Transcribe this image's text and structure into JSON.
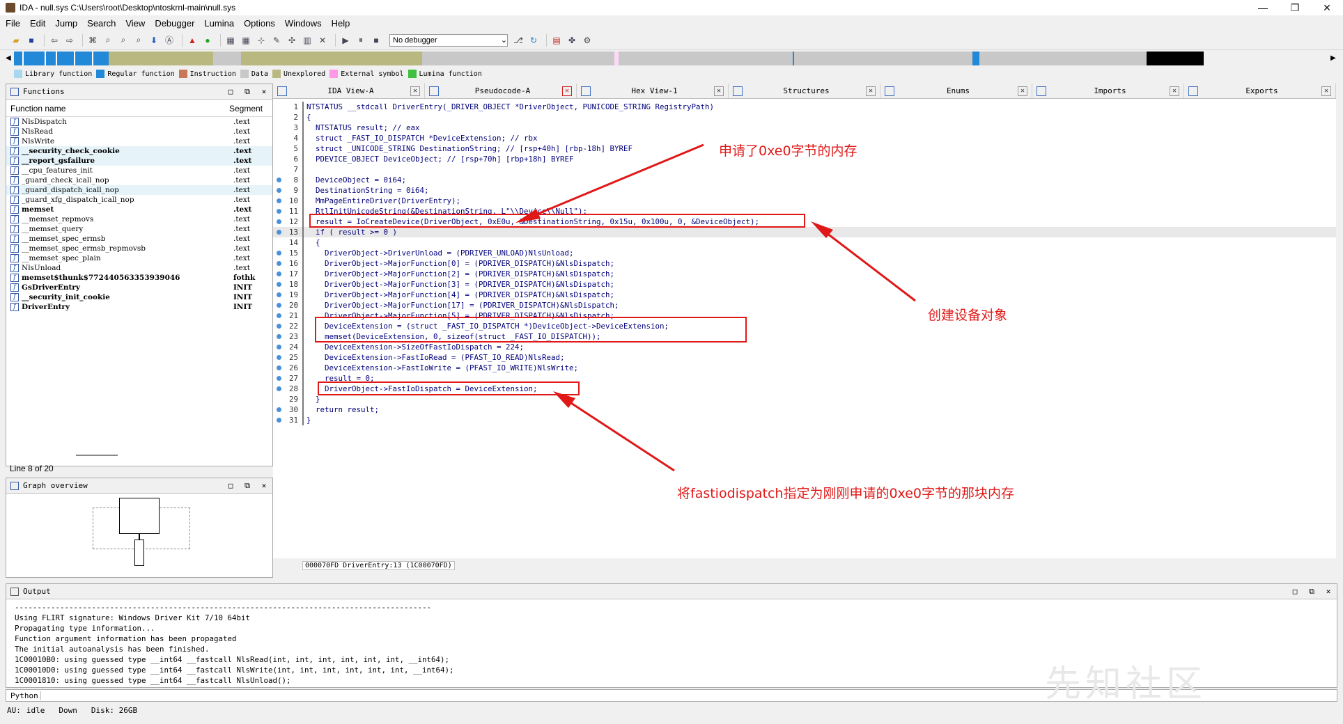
{
  "window": {
    "title": "IDA - null.sys C:\\Users\\root\\Desktop\\ntoskrnl-main\\null.sys",
    "minimize": "—",
    "maximize": "❐",
    "close": "✕"
  },
  "menu": [
    "File",
    "Edit",
    "Jump",
    "Search",
    "View",
    "Debugger",
    "Lumina",
    "Options",
    "Windows",
    "Help"
  ],
  "toolbar": {
    "debugger": "No debugger"
  },
  "legend": [
    {
      "label": "Library function",
      "color": "#a8d8f0"
    },
    {
      "label": "Regular function",
      "color": "#2288d8"
    },
    {
      "label": "Instruction",
      "color": "#c87858"
    },
    {
      "label": "Data",
      "color": "#c8c8c8"
    },
    {
      "label": "Unexplored",
      "color": "#b8b880"
    },
    {
      "label": "External symbol",
      "color": "#ff98e8"
    },
    {
      "label": "Lumina function",
      "color": "#40c040"
    }
  ],
  "navband": [
    {
      "w": 12,
      "c": "#2288d8"
    },
    {
      "w": 2,
      "c": "#fff"
    },
    {
      "w": 30,
      "c": "#2288d8"
    },
    {
      "w": 2,
      "c": "#fff"
    },
    {
      "w": 14,
      "c": "#2288d8"
    },
    {
      "w": 2,
      "c": "#fff"
    },
    {
      "w": 24,
      "c": "#2288d8"
    },
    {
      "w": 2,
      "c": "#fff"
    },
    {
      "w": 24,
      "c": "#2288d8"
    },
    {
      "w": 2,
      "c": "#fff"
    },
    {
      "w": 22,
      "c": "#2288d8"
    },
    {
      "w": 150,
      "c": "#b8b880"
    },
    {
      "w": 40,
      "c": "#c8c8c8"
    },
    {
      "w": 260,
      "c": "#b8b880"
    },
    {
      "w": 276,
      "c": "#c8c8c8"
    },
    {
      "w": 6,
      "c": "#ffd8f8"
    },
    {
      "w": 250,
      "c": "#c8c8c8"
    },
    {
      "w": 2,
      "c": "#2288d8"
    },
    {
      "w": 256,
      "c": "#c8c8c8"
    },
    {
      "w": 10,
      "c": "#2288d8"
    },
    {
      "w": 240,
      "c": "#c8c8c8"
    },
    {
      "w": 82,
      "c": "#000"
    }
  ],
  "functions": {
    "title": "Functions",
    "col_name": "Function name",
    "col_segment": "Segment",
    "rows": [
      {
        "name": "NlsDispatch",
        "seg": ".text",
        "bold": false,
        "hl": false
      },
      {
        "name": "NlsRead",
        "seg": ".text",
        "bold": false,
        "hl": false
      },
      {
        "name": "NlsWrite",
        "seg": ".text",
        "bold": false,
        "hl": false
      },
      {
        "name": "__security_check_cookie",
        "seg": ".text",
        "bold": true,
        "hl": true
      },
      {
        "name": "__report_gsfailure",
        "seg": ".text",
        "bold": true,
        "hl": true
      },
      {
        "name": "__cpu_features_init",
        "seg": ".text",
        "bold": false,
        "hl": false
      },
      {
        "name": "_guard_check_icall_nop",
        "seg": ".text",
        "bold": false,
        "hl": false
      },
      {
        "name": "_guard_dispatch_icall_nop",
        "seg": ".text",
        "bold": false,
        "hl": true
      },
      {
        "name": "_guard_xfg_dispatch_icall_nop",
        "seg": ".text",
        "bold": false,
        "hl": false
      },
      {
        "name": "memset",
        "seg": ".text",
        "bold": true,
        "hl": false
      },
      {
        "name": "__memset_repmovs",
        "seg": ".text",
        "bold": false,
        "hl": false
      },
      {
        "name": "__memset_query",
        "seg": ".text",
        "bold": false,
        "hl": false
      },
      {
        "name": "__memset_spec_ermsb",
        "seg": ".text",
        "bold": false,
        "hl": false
      },
      {
        "name": "__memset_spec_ermsb_repmovsb",
        "seg": ".text",
        "bold": false,
        "hl": false
      },
      {
        "name": "__memset_spec_plain",
        "seg": ".text",
        "bold": false,
        "hl": false
      },
      {
        "name": "NlsUnload",
        "seg": ".text",
        "bold": false,
        "hl": false
      },
      {
        "name": "memset$thunk$772440563353939046",
        "seg": "fothk",
        "bold": true,
        "hl": false
      },
      {
        "name": "GsDriverEntry",
        "seg": "INIT",
        "bold": true,
        "hl": false
      },
      {
        "name": "__security_init_cookie",
        "seg": "INIT",
        "bold": true,
        "hl": false
      },
      {
        "name": "DriverEntry",
        "seg": "INIT",
        "bold": true,
        "hl": false
      }
    ],
    "line_status": "Line 8 of 20"
  },
  "graph": {
    "title": "Graph overview"
  },
  "tabs": [
    {
      "label": "IDA View-A",
      "active": false
    },
    {
      "label": "Pseudocode-A",
      "active": true
    },
    {
      "label": "Hex View-1",
      "active": false
    },
    {
      "label": "Structures",
      "active": false
    },
    {
      "label": "Enums",
      "active": false
    },
    {
      "label": "Imports",
      "active": false
    },
    {
      "label": "Exports",
      "active": false
    }
  ],
  "code": [
    {
      "n": "1",
      "t": "NTSTATUS __stdcall DriverEntry(_DRIVER_OBJECT *DriverObject, PUNICODE_STRING RegistryPath)",
      "dot": false
    },
    {
      "n": "2",
      "t": "{",
      "dot": false
    },
    {
      "n": "3",
      "t": "  NTSTATUS result; // eax",
      "dot": false
    },
    {
      "n": "4",
      "t": "  struct _FAST_IO_DISPATCH *DeviceExtension; // rbx",
      "dot": false
    },
    {
      "n": "5",
      "t": "  struct _UNICODE_STRING DestinationString; // [rsp+40h] [rbp-18h] BYREF",
      "dot": false
    },
    {
      "n": "6",
      "t": "  PDEVICE_OBJECT DeviceObject; // [rsp+70h] [rbp+18h] BYREF",
      "dot": false
    },
    {
      "n": "7",
      "t": "",
      "dot": false
    },
    {
      "n": "8",
      "t": "  DeviceObject = 0i64;",
      "dot": true
    },
    {
      "n": "9",
      "t": "  DestinationString = 0i64;",
      "dot": true
    },
    {
      "n": "10",
      "t": "  MmPageEntireDriver(DriverEntry);",
      "dot": true
    },
    {
      "n": "11",
      "t": "  RtlInitUnicodeString(&DestinationString, L\"\\\\Device\\\\Null\");",
      "dot": true
    },
    {
      "n": "12",
      "t": "  result = IoCreateDevice(DriverObject, 0xE0u, &DestinationString, 0x15u, 0x100u, 0, &DeviceObject);",
      "dot": true
    },
    {
      "n": "13",
      "t": "  if ( result >= 0 )",
      "dot": true,
      "hl": true
    },
    {
      "n": "14",
      "t": "  {",
      "dot": false
    },
    {
      "n": "15",
      "t": "    DriverObject->DriverUnload = (PDRIVER_UNLOAD)NlsUnload;",
      "dot": true
    },
    {
      "n": "16",
      "t": "    DriverObject->MajorFunction[0] = (PDRIVER_DISPATCH)&NlsDispatch;",
      "dot": true
    },
    {
      "n": "17",
      "t": "    DriverObject->MajorFunction[2] = (PDRIVER_DISPATCH)&NlsDispatch;",
      "dot": true
    },
    {
      "n": "18",
      "t": "    DriverObject->MajorFunction[3] = (PDRIVER_DISPATCH)&NlsDispatch;",
      "dot": true
    },
    {
      "n": "19",
      "t": "    DriverObject->MajorFunction[4] = (PDRIVER_DISPATCH)&NlsDispatch;",
      "dot": true
    },
    {
      "n": "20",
      "t": "    DriverObject->MajorFunction[17] = (PDRIVER_DISPATCH)&NlsDispatch;",
      "dot": true
    },
    {
      "n": "21",
      "t": "    DriverObject->MajorFunction[5] = (PDRIVER_DISPATCH)&NlsDispatch;",
      "dot": true
    },
    {
      "n": "22",
      "t": "    DeviceExtension = (struct _FAST_IO_DISPATCH *)DeviceObject->DeviceExtension;",
      "dot": true
    },
    {
      "n": "23",
      "t": "    memset(DeviceExtension, 0, sizeof(struct _FAST_IO_DISPATCH));",
      "dot": true
    },
    {
      "n": "24",
      "t": "    DeviceExtension->SizeOfFastIoDispatch = 224;",
      "dot": true
    },
    {
      "n": "25",
      "t": "    DeviceExtension->FastIoRead = (PFAST_IO_READ)NlsRead;",
      "dot": true
    },
    {
      "n": "26",
      "t": "    DeviceExtension->FastIoWrite = (PFAST_IO_WRITE)NlsWrite;",
      "dot": true
    },
    {
      "n": "27",
      "t": "    result = 0;",
      "dot": true
    },
    {
      "n": "28",
      "t": "    DriverObject->FastIoDispatch = DeviceExtension;",
      "dot": true
    },
    {
      "n": "29",
      "t": "  }",
      "dot": false
    },
    {
      "n": "30",
      "t": "  return result;",
      "dot": true
    },
    {
      "n": "31",
      "t": "}",
      "dot": true
    }
  ],
  "code_status": "000070FD DriverEntry:13 (1C00070FD)",
  "annotations": {
    "a1": "申请了0xe0字节的内存",
    "a2": "创建设备对象",
    "a3": "将fastiodispatch指定为刚刚申请的0xe0字节的那块内存"
  },
  "output": {
    "title": "Output",
    "text": "--------------------------------------------------------------------------------------------\nUsing FLIRT signature: Windows Driver Kit 7/10 64bit\nPropagating type information...\nFunction argument information has been propagated\nThe initial autoanalysis has been finished.\n1C00010B0: using guessed type __int64 __fastcall NlsRead(int, int, int, int, int, int, __int64);\n1C00010D0: using guessed type __int64 __fastcall NlsWrite(int, int, int, int, int, int, __int64);\n1C0001810: using guessed type __int64 __fastcall NlsUnload();"
  },
  "python_label": "Python",
  "status": {
    "au": "AU:",
    "state": "idle",
    "dir": "Down",
    "disk": "Disk: 26GB"
  },
  "watermark": "先知社区"
}
